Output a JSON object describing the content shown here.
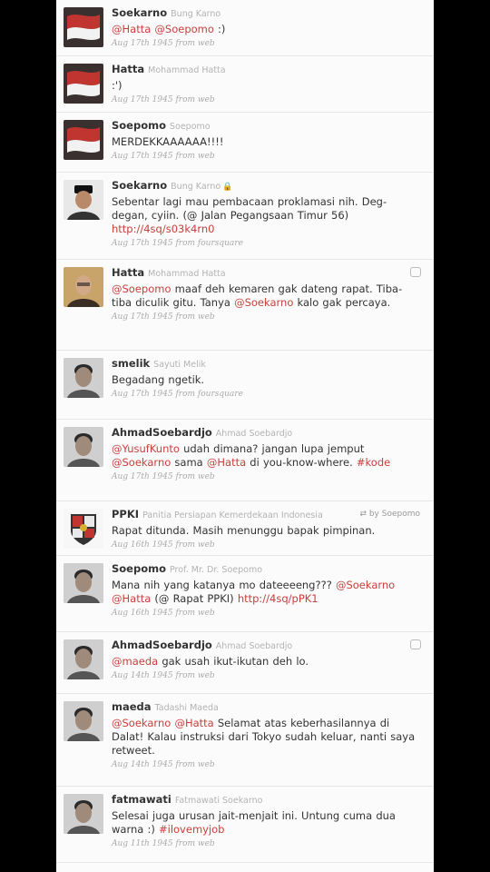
{
  "tweets": [
    {
      "screen": "Soekarno",
      "fullname": "Bung Karno",
      "segments": [
        {
          "t": "@Hatta @Soepomo",
          "m": true
        },
        {
          "t": " :)"
        }
      ],
      "date": "Aug 17th 1945",
      "via": "web",
      "avatar": "flag"
    },
    {
      "screen": "Hatta",
      "fullname": "Mohammad Hatta",
      "segments": [
        {
          "t": ":')"
        }
      ],
      "date": "Aug 17th 1945",
      "via": "web",
      "avatar": "flag"
    },
    {
      "screen": "Soepomo",
      "fullname": "Soepomo",
      "segments": [
        {
          "t": "MERDEKKAAAAAA!!!!"
        }
      ],
      "date": "Aug 17th 1945",
      "via": "web",
      "avatar": "flag"
    },
    {
      "screen": "Soekarno",
      "fullname": "Bung Karno",
      "lock": "🔒",
      "segments": [
        {
          "t": "Sebentar lagi mau pembacaan proklamasi nih. Deg-degan, cyiin. (@ Jalan Pegangsaan Timur 56) "
        },
        {
          "t": "http://4sq/s03k4rn0",
          "m": true
        }
      ],
      "date": "Aug 17th 1945",
      "via": "foursquare",
      "avatar": "soekarno"
    },
    {
      "screen": "Hatta",
      "fullname": "Mohammad Hatta",
      "segments": [
        {
          "t": "@Soepomo",
          "m": true
        },
        {
          "t": " maaf deh kemaren gak dateng rapat. Tiba-tiba diculik gitu. Tanya "
        },
        {
          "t": "@Soekarno",
          "m": true
        },
        {
          "t": " kalo gak percaya."
        }
      ],
      "date": "Aug 17th 1945",
      "via": "web",
      "avatar": "hatta",
      "reply": true
    },
    {
      "screen": "smelik",
      "fullname": "Sayuti Melik",
      "segments": [
        {
          "t": "Begadang ngetik."
        }
      ],
      "date": "Aug 17th 1945",
      "via": "foursquare",
      "avatar": "face"
    },
    {
      "screen": "AhmadSoebardjo",
      "fullname": "Ahmad Soebardjo",
      "segments": [
        {
          "t": "@YusufKunto",
          "m": true
        },
        {
          "t": " udah dimana? jangan lupa jemput "
        },
        {
          "t": "@Soekarno",
          "m": true
        },
        {
          "t": " sama "
        },
        {
          "t": "@Hatta",
          "m": true
        },
        {
          "t": " di you-know-where. "
        },
        {
          "t": "#kode",
          "m": true
        }
      ],
      "date": "Aug 17th 1945",
      "via": "web",
      "avatar": "face"
    },
    {
      "screen": "PPKI",
      "fullname": "Panitia Persiapan Kemerdekaan Indonesia",
      "rt": "⇄ by Soepomo",
      "segments": [
        {
          "t": "Rapat ditunda. Masih menunggu bapak pimpinan."
        }
      ],
      "date": "Aug 16th 1945",
      "via": "web",
      "avatar": "shield"
    },
    {
      "screen": "Soepomo",
      "fullname": "Prof. Mr. Dr. Soepomo",
      "segments": [
        {
          "t": "Mana nih yang katanya mo dateeeeng??? "
        },
        {
          "t": "@Soekarno",
          "m": true
        },
        {
          "t": " "
        },
        {
          "t": "@Hatta",
          "m": true
        },
        {
          "t": " (@ Rapat PPKI) "
        },
        {
          "t": "http://4sq/pPK1",
          "m": true
        }
      ],
      "date": "Aug 16th 1945",
      "via": "web",
      "avatar": "face"
    },
    {
      "screen": "AhmadSoebardjo",
      "fullname": "Ahmad Soebardjo",
      "segments": [
        {
          "t": "@maeda",
          "m": true
        },
        {
          "t": " gak usah ikut-ikutan deh lo."
        }
      ],
      "date": "Aug 14th 1945",
      "via": "web",
      "avatar": "face",
      "reply": true
    },
    {
      "screen": "maeda",
      "fullname": "Tadashi Maeda",
      "segments": [
        {
          "t": "@Soekarno",
          "m": true
        },
        {
          "t": " "
        },
        {
          "t": "@Hatta",
          "m": true
        },
        {
          "t": " Selamat atas keberhasilannya di Dalat! Kalau instruksi dari Tokyo sudah keluar, nanti saya retweet."
        }
      ],
      "date": "Aug 14th 1945",
      "via": "web",
      "avatar": "face"
    },
    {
      "screen": "fatmawati",
      "fullname": "Fatmawati Soekarno",
      "segments": [
        {
          "t": "Selesai juga urusan jait-menjait ini. Untung cuma dua warna :) "
        },
        {
          "t": "#ilovemyjob",
          "m": true
        }
      ],
      "date": "Aug 11th 1945",
      "via": "web",
      "avatar": "face"
    }
  ],
  "labels": {
    "from": "from"
  },
  "colors": {
    "mention": "#c8403d",
    "background": "#000000",
    "panel": "#fbfbfb"
  }
}
